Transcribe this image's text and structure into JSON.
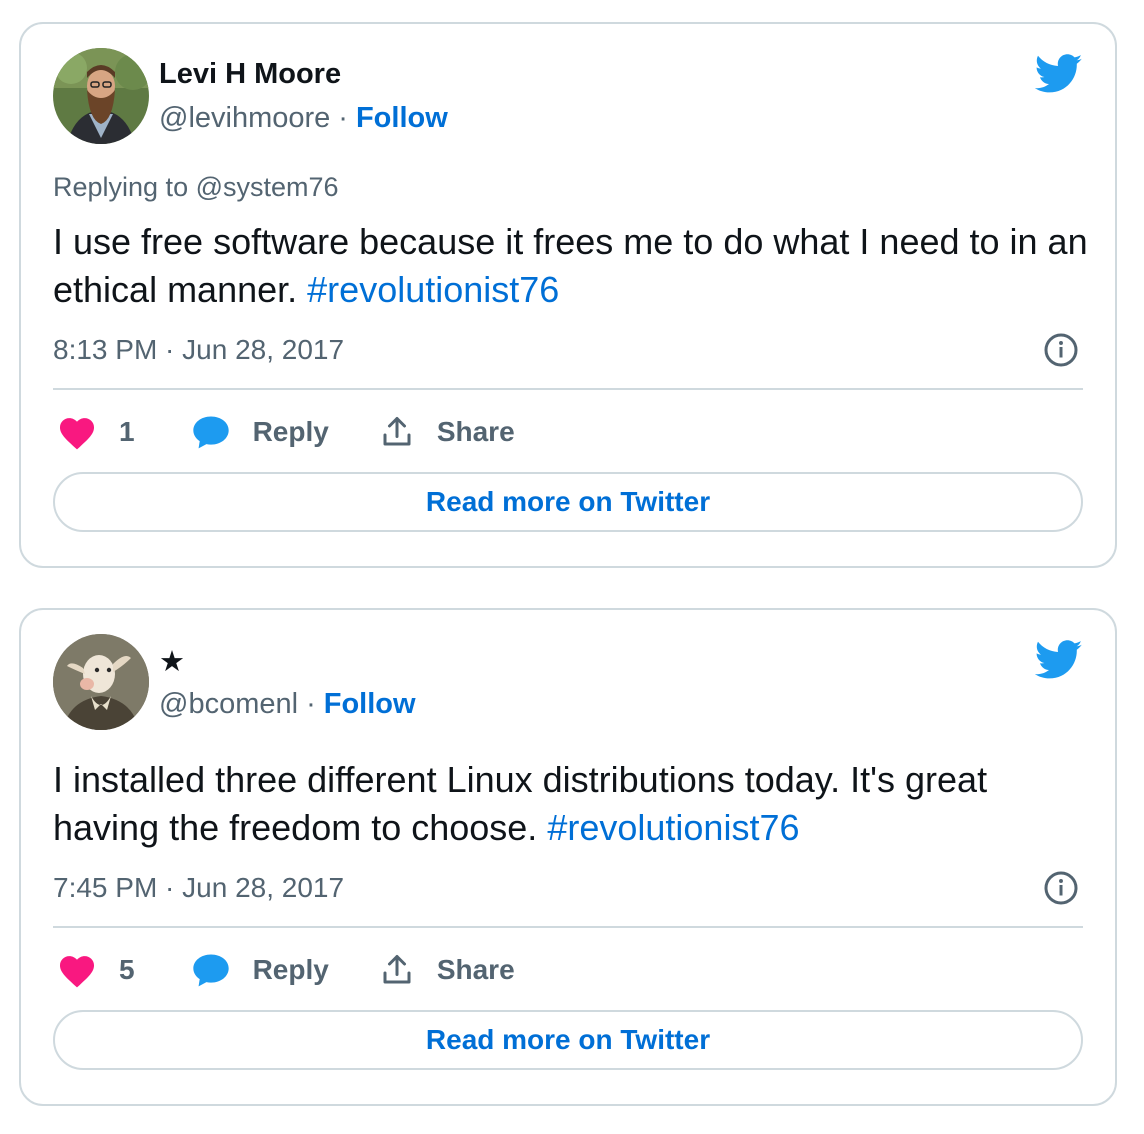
{
  "colors": {
    "link": "#006fd6",
    "secondary_text": "#536471",
    "primary_text": "#0f1419",
    "border": "#cfd9de",
    "like_heart": "#f91880",
    "twitter_blue": "#1d9bf0"
  },
  "tweets": [
    {
      "author_name": "Levi H Moore",
      "handle": "@levihmoore",
      "separator": "·",
      "follow_label": "Follow",
      "reply_to": "Replying to @system76",
      "text": "I use free software because it frees me to do what I need to in an ethical manner. ",
      "hashtag": "#revolutionist76",
      "timestamp": "8:13 PM · Jun 28, 2017",
      "like_count": "1",
      "reply_label": "Reply",
      "share_label": "Share",
      "read_more_label": "Read more on Twitter",
      "avatar_icon": "bearded-man-avatar",
      "brand_icon": "twitter-bird-icon"
    },
    {
      "author_name": "★",
      "handle": "@bcomenl",
      "separator": "·",
      "follow_label": "Follow",
      "text": "I installed three different Linux distributions today. It's great having the freedom to choose. ",
      "hashtag": "#revolutionist76",
      "timestamp": "7:45 PM · Jun 28, 2017",
      "like_count": "5",
      "reply_label": "Reply",
      "share_label": "Share",
      "read_more_label": "Read more on Twitter",
      "avatar_icon": "goat-portrait-avatar",
      "brand_icon": "twitter-bird-icon"
    }
  ]
}
